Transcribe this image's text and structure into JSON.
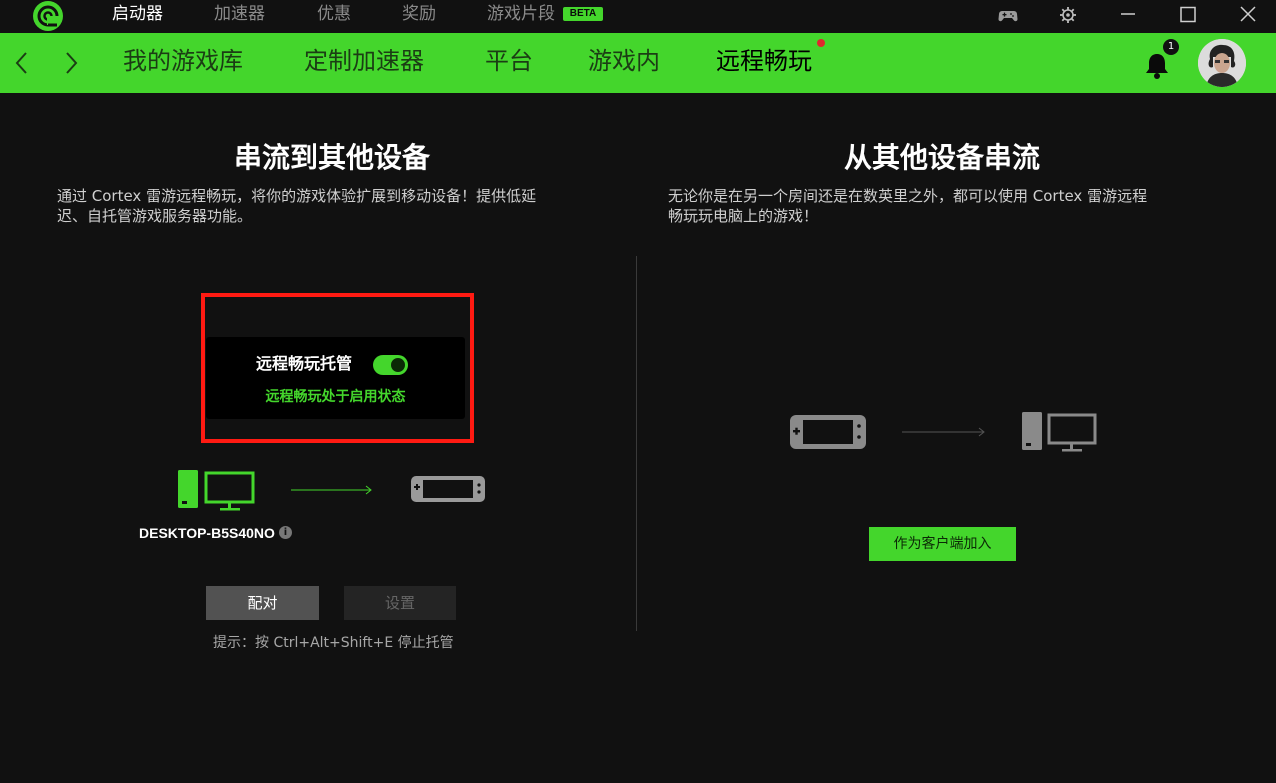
{
  "titlebar": {
    "tabs": [
      {
        "label": "启动器"
      },
      {
        "label": "加速器"
      },
      {
        "label": "优惠"
      },
      {
        "label": "奖励"
      },
      {
        "label": "游戏片段"
      }
    ],
    "beta_badge": "BETA"
  },
  "nav": {
    "tabs": [
      {
        "label": "我的游戏库"
      },
      {
        "label": "定制加速器"
      },
      {
        "label": "平台"
      },
      {
        "label": "游戏内"
      },
      {
        "label": "远程畅玩"
      }
    ],
    "active_tab": "远程畅玩",
    "notification_count": "1"
  },
  "left": {
    "title": "串流到其他设备",
    "description_line1": "通过 Cortex 雷游远程畅玩，将你的游戏体验扩展到移动设备！提供低延",
    "description_line2": "迟、自托管游戏服务器功能。",
    "host_card": {
      "label": "远程畅玩托管",
      "toggle_on": true,
      "status": "远程畅玩处于启用状态"
    },
    "device_name": "DESKTOP-B5S40NO",
    "pair_button": "配对",
    "settings_button": "设置",
    "hint": "提示：按 Ctrl+Alt+Shift+E 停止托管"
  },
  "right": {
    "title": "从其他设备串流",
    "description_line1": "无论你是在另一个房间还是在数英里之外，都可以使用 Cortex 雷游远程",
    "description_line2": "畅玩玩电脑上的游戏！",
    "join_button": "作为客户端加入"
  },
  "colors": {
    "accent": "#44d62c",
    "background": "#111111",
    "highlight": "#ff1a12"
  }
}
